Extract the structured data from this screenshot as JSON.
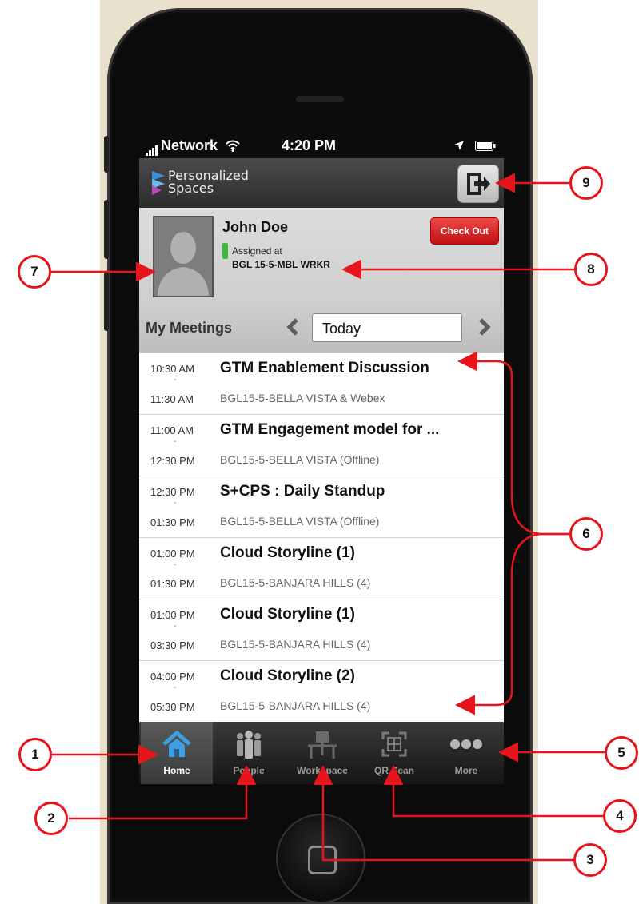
{
  "status_bar": {
    "network": "Network",
    "time": "4:20 PM"
  },
  "app_header": {
    "logo_line1": "Personalized",
    "logo_line2": "Spaces"
  },
  "profile": {
    "name": "John Doe",
    "assigned_label": "Assigned at",
    "assigned_location": "BGL 15-5-MBL WRKR",
    "checkout_label": "Check Out"
  },
  "meetings_header": {
    "title": "My Meetings",
    "date_value": "Today"
  },
  "meetings": [
    {
      "start": "10:30 AM",
      "end": "11:30 AM",
      "title": "GTM Enablement Discussion",
      "location": "BGL15-5-BELLA VISTA & Webex"
    },
    {
      "start": "11:00 AM",
      "end": "12:30 PM",
      "title": "GTM Engagement model for ...",
      "location": "BGL15-5-BELLA VISTA (Offline)"
    },
    {
      "start": "12:30 PM",
      "end": "01:30 PM",
      "title": "S+CPS : Daily Standup",
      "location": "BGL15-5-BELLA VISTA (Offline)"
    },
    {
      "start": "01:00 PM",
      "end": "01:30 PM",
      "title": "Cloud Storyline (1)",
      "location": "BGL15-5-BANJARA HILLS (4)"
    },
    {
      "start": "01:00 PM",
      "end": "03:30 PM",
      "title": "Cloud Storyline (1)",
      "location": "BGL15-5-BANJARA HILLS (4)"
    },
    {
      "start": "04:00 PM",
      "end": "05:30 PM",
      "title": "Cloud Storyline (2)",
      "location": "BGL15-5-BANJARA HILLS (4)"
    }
  ],
  "tabs": [
    {
      "label": "Home",
      "icon": "home-icon",
      "active": true
    },
    {
      "label": "People",
      "icon": "people-icon",
      "active": false
    },
    {
      "label": "Workspace",
      "icon": "workspace-icon",
      "active": false
    },
    {
      "label": "QR Scan",
      "icon": "qr-scan-icon",
      "active": false
    },
    {
      "label": "More",
      "icon": "more-icon",
      "active": false
    }
  ],
  "annotations": [
    "1",
    "2",
    "3",
    "4",
    "5",
    "6",
    "7",
    "8",
    "9"
  ],
  "colors": {
    "annotation_red": "#e8141b",
    "checkout_red": "#d42020",
    "status_green": "#3cba3c",
    "home_icon_blue": "#3aa0e0"
  }
}
